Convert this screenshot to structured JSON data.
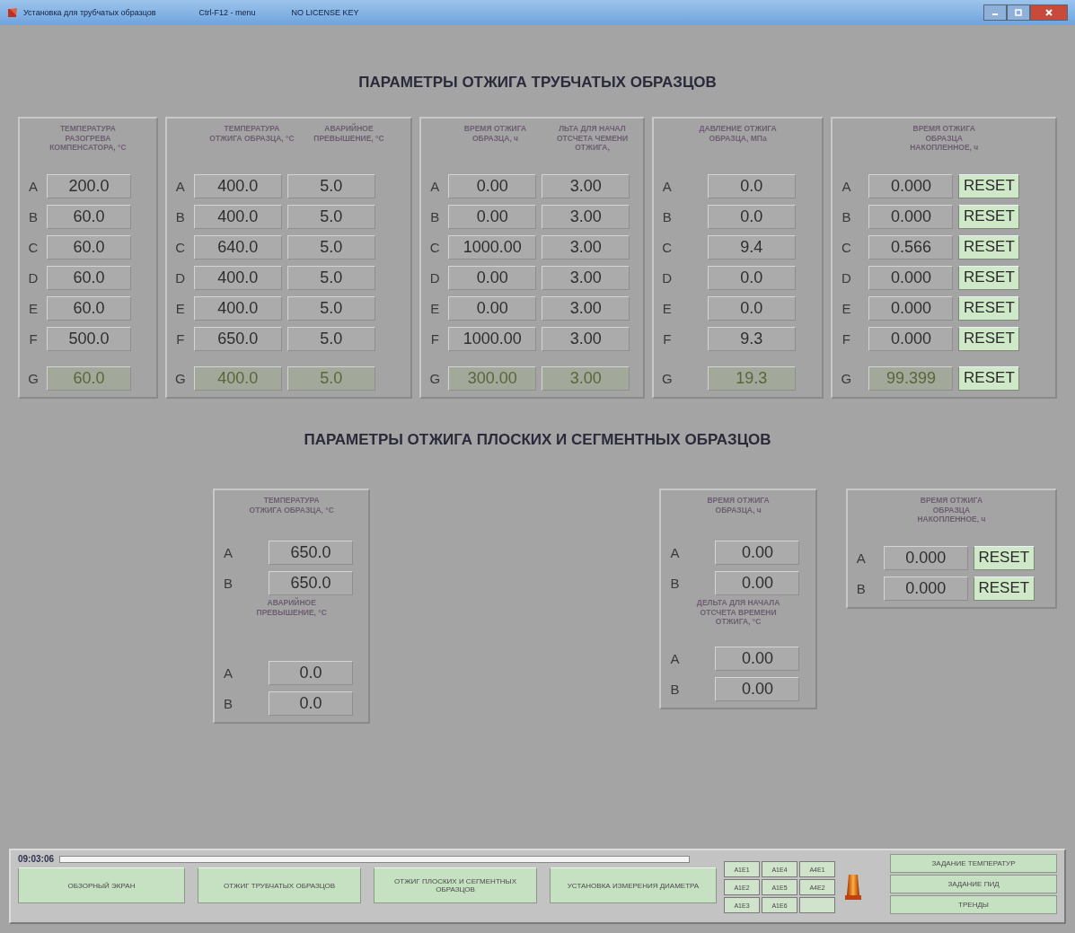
{
  "window": {
    "title": "Установка для трубчатых образцов",
    "hint": "Ctrl-F12 - menu",
    "license": "NO LICENSE KEY"
  },
  "sections": [
    {
      "title": "ПАРАМЕТРЫ ОТЖИГА ТРУБЧАТЫХ ОБРАЗЦОВ",
      "panels": [
        {
          "groups": [
            {
              "headers": [
                "ТЕМПЕРАТУРА РАЗОГРЕВА КОМПЕНСАТОРА, °C"
              ],
              "rows": [
                {
                  "label": "A",
                  "values": [
                    "200.0"
                  ],
                  "summary": false
                },
                {
                  "label": "B",
                  "values": [
                    "60.0"
                  ],
                  "summary": false
                },
                {
                  "label": "C",
                  "values": [
                    "60.0"
                  ],
                  "summary": false
                },
                {
                  "label": "D",
                  "values": [
                    "60.0"
                  ],
                  "summary": false
                },
                {
                  "label": "E",
                  "values": [
                    "60.0"
                  ],
                  "summary": false
                },
                {
                  "label": "F",
                  "values": [
                    "500.0"
                  ],
                  "summary": false
                },
                {
                  "label": "G",
                  "values": [
                    "60.0"
                  ],
                  "summary": true
                }
              ]
            }
          ]
        },
        {
          "groups": [
            {
              "headers": [
                "ТЕМПЕРАТУРА ОТЖИГА ОБРАЗЦА, °C",
                "АВАРИЙНОЕ ПРЕВЫШЕНИЕ, °C"
              ],
              "rows": [
                {
                  "label": "A",
                  "values": [
                    "400.0",
                    "5.0"
                  ],
                  "summary": false
                },
                {
                  "label": "B",
                  "values": [
                    "400.0",
                    "5.0"
                  ],
                  "summary": false
                },
                {
                  "label": "C",
                  "values": [
                    "640.0",
                    "5.0"
                  ],
                  "summary": false
                },
                {
                  "label": "D",
                  "values": [
                    "400.0",
                    "5.0"
                  ],
                  "summary": false
                },
                {
                  "label": "E",
                  "values": [
                    "400.0",
                    "5.0"
                  ],
                  "summary": false
                },
                {
                  "label": "F",
                  "values": [
                    "650.0",
                    "5.0"
                  ],
                  "summary": false
                },
                {
                  "label": "G",
                  "values": [
                    "400.0",
                    "5.0"
                  ],
                  "summary": true
                }
              ]
            }
          ]
        },
        {
          "groups": [
            {
              "headers": [
                "ВРЕМЯ ОТЖИГА ОБРАЗЦА, ч",
                "ЛЬТА ДЛЯ НАЧАЛ ОТСЧЕТА ЧЕМЕНИ ОТЖИГА,"
              ],
              "rows": [
                {
                  "label": "A",
                  "values": [
                    "0.00",
                    "3.00"
                  ],
                  "summary": false
                },
                {
                  "label": "B",
                  "values": [
                    "0.00",
                    "3.00"
                  ],
                  "summary": false
                },
                {
                  "label": "C",
                  "values": [
                    "1000.00",
                    "3.00"
                  ],
                  "summary": false
                },
                {
                  "label": "D",
                  "values": [
                    "0.00",
                    "3.00"
                  ],
                  "summary": false
                },
                {
                  "label": "E",
                  "values": [
                    "0.00",
                    "3.00"
                  ],
                  "summary": false
                },
                {
                  "label": "F",
                  "values": [
                    "1000.00",
                    "3.00"
                  ],
                  "summary": false
                },
                {
                  "label": "G",
                  "values": [
                    "300.00",
                    "3.00"
                  ],
                  "summary": true
                }
              ]
            }
          ]
        },
        {
          "groups": [
            {
              "headers": [
                "ДАВЛЕНИЕ ОТЖИГА ОБРАЗЦА, МПа"
              ],
              "rows": [
                {
                  "label": "A",
                  "values": [
                    "0.0"
                  ],
                  "summary": false
                },
                {
                  "label": "B",
                  "values": [
                    "0.0"
                  ],
                  "summary": false
                },
                {
                  "label": "C",
                  "values": [
                    "9.4"
                  ],
                  "summary": false
                },
                {
                  "label": "D",
                  "values": [
                    "0.0"
                  ],
                  "summary": false
                },
                {
                  "label": "E",
                  "values": [
                    "0.0"
                  ],
                  "summary": false
                },
                {
                  "label": "F",
                  "values": [
                    "9.3"
                  ],
                  "summary": false
                },
                {
                  "label": "G",
                  "values": [
                    "19.3"
                  ],
                  "summary": true
                }
              ]
            }
          ]
        },
        {
          "groups": [
            {
              "headers": [
                "ВРЕМЯ ОТЖИГА ОБРАЗЦА НАКОПЛЕННОЕ, ч"
              ],
              "rows": [
                {
                  "label": "A",
                  "values": [
                    "0.000"
                  ],
                  "reset": "RESET",
                  "summary": false
                },
                {
                  "label": "B",
                  "values": [
                    "0.000"
                  ],
                  "reset": "RESET",
                  "summary": false
                },
                {
                  "label": "C",
                  "values": [
                    "0.566"
                  ],
                  "reset": "RESET",
                  "summary": false
                },
                {
                  "label": "D",
                  "values": [
                    "0.000"
                  ],
                  "reset": "RESET",
                  "summary": false
                },
                {
                  "label": "E",
                  "values": [
                    "0.000"
                  ],
                  "reset": "RESET",
                  "summary": false
                },
                {
                  "label": "F",
                  "values": [
                    "0.000"
                  ],
                  "reset": "RESET",
                  "summary": false
                },
                {
                  "label": "G",
                  "values": [
                    "99.399"
                  ],
                  "reset": "RESET",
                  "summary": true
                }
              ]
            }
          ]
        }
      ]
    },
    {
      "title": "ПАРАМЕТРЫ ОТЖИГА ПЛОСКИХ И СЕГМЕНТНЫХ ОБРАЗЦОВ",
      "panels": [
        {
          "groups": [
            {
              "headers": [
                "ТЕМПЕРАТУРА ОТЖИГА ОБРАЗЦА, °C"
              ],
              "rows": [
                {
                  "label": "A",
                  "values": [
                    "650.0"
                  ],
                  "summary": false
                },
                {
                  "label": "B",
                  "values": [
                    "650.0"
                  ],
                  "summary": false
                }
              ]
            },
            {
              "headers": [
                "АВАРИЙНОЕ ПРЕВЫШЕНИЕ, °C"
              ],
              "rows": [
                {
                  "label": "A",
                  "values": [
                    "0.0"
                  ],
                  "summary": false
                },
                {
                  "label": "B",
                  "values": [
                    "0.0"
                  ],
                  "summary": false
                }
              ]
            }
          ]
        },
        {
          "groups": [
            {
              "headers": [
                "ВРЕМЯ ОТЖИГА ОБРАЗЦА, ч"
              ],
              "rows": [
                {
                  "label": "A",
                  "values": [
                    "0.00"
                  ],
                  "summary": false
                },
                {
                  "label": "B",
                  "values": [
                    "0.00"
                  ],
                  "summary": false
                }
              ]
            },
            {
              "headers": [
                "ДЕЛЬТА ДЛЯ НАЧАЛА ОТСЧЕТА ВРЕМЕНИ ОТЖИГА, °C"
              ],
              "rows": [
                {
                  "label": "A",
                  "values": [
                    "0.00"
                  ],
                  "summary": false
                },
                {
                  "label": "B",
                  "values": [
                    "0.00"
                  ],
                  "summary": false
                }
              ]
            }
          ]
        },
        {
          "groups": [
            {
              "headers": [
                "ВРЕМЯ ОТЖИГА ОБРАЗЦА НАКОПЛЕННОЕ, ч"
              ],
              "rows": [
                {
                  "label": "A",
                  "values": [
                    "0.000"
                  ],
                  "reset": "RESET",
                  "summary": false
                },
                {
                  "label": "B",
                  "values": [
                    "0.000"
                  ],
                  "reset": "RESET",
                  "summary": false
                }
              ]
            }
          ]
        }
      ]
    }
  ],
  "bottom_bar": {
    "time": "09:03:06",
    "nav_buttons": [
      "ОБЗОРНЫЙ ЭКРАН",
      "ОТЖИГ ТРУБЧАТЫХ ОБРАЗЦОВ",
      "ОТЖИГ ПЛОСКИХ И СЕГМЕНТНЫХ ОБРАЗЦОВ",
      "УСТАНОВКА ИЗМЕРЕНИЯ ДИАМЕТРА"
    ],
    "alarm_buttons": [
      "А1Е1",
      "А1Е4",
      "А4Е1",
      "А1Е2",
      "А1Е5",
      "А4Е2",
      "А1Е3",
      "А1Е6"
    ],
    "side_buttons": [
      "ЗАДАНИЕ ТЕМПЕРАТУР",
      "ЗАДАНИЕ ПИД",
      "ТРЕНДЫ"
    ]
  }
}
